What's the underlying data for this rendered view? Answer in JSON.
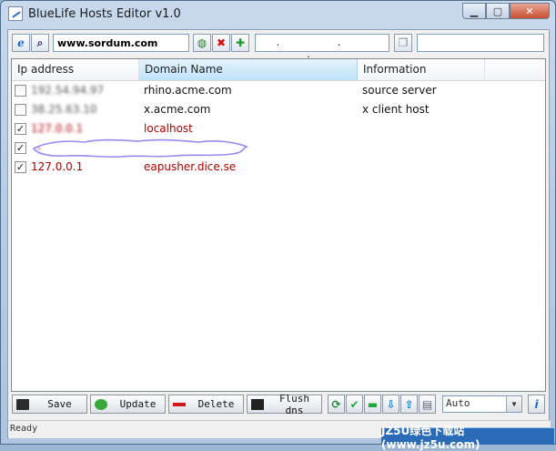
{
  "window": {
    "title": "BlueLife Hosts Editor v1.0"
  },
  "toolbar": {
    "search_value": "www.sordum.com",
    "ip_value": ". . .",
    "info_value": "",
    "icons": [
      "ie-icon",
      "search-icon",
      "globe-icon",
      "delete-icon",
      "add-icon",
      "copy-icon"
    ]
  },
  "columns": {
    "ip": "Ip address",
    "domain": "Domain Name",
    "info": "Information"
  },
  "rows": [
    {
      "checked": false,
      "ip": "192.54.94.97",
      "domain": "rhino.acme.com",
      "info": "source server",
      "red": false
    },
    {
      "checked": false,
      "ip": "38.25.63.10",
      "domain": "x.acme.com",
      "info": "x client host",
      "red": false
    },
    {
      "checked": true,
      "ip": "127.0.0.1",
      "domain": "localhost",
      "info": "",
      "red": true
    },
    {
      "checked": true,
      "ip": "",
      "domain": "",
      "info": "",
      "red": true,
      "redacted": true
    },
    {
      "checked": true,
      "ip": "127.0.0.1",
      "domain": "eapusher.dice.se",
      "info": "",
      "red": true
    }
  ],
  "actions": {
    "save": "Save",
    "update": "Update",
    "delete": "Delete",
    "flush": "Flush dns"
  },
  "encoding": {
    "selected": "Auto"
  },
  "status": {
    "text": "Ready"
  },
  "watermark": {
    "text": "JZ5U绿色下载站(www.jz5u.com)"
  },
  "colors": {
    "highlight_row_text": "#b00000",
    "sorted_header": "#bde3f8"
  }
}
